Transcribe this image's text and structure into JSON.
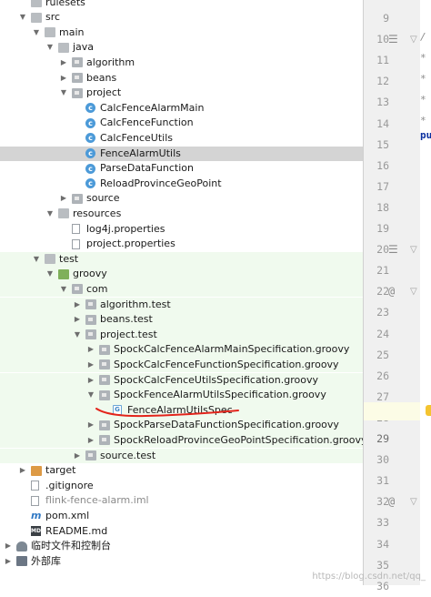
{
  "tree": [
    {
      "label": "rulesets",
      "depth": 0,
      "arrow": "",
      "icon": "folder",
      "icon_name": "folder-icon"
    },
    {
      "label": "src",
      "depth": 0,
      "arrow": "down",
      "icon": "folder",
      "icon_name": "folder-icon"
    },
    {
      "label": "main",
      "depth": 1,
      "arrow": "down",
      "icon": "folder",
      "icon_name": "folder-icon"
    },
    {
      "label": "java",
      "depth": 2,
      "arrow": "down",
      "icon": "folder",
      "icon_name": "source-root-folder-icon"
    },
    {
      "label": "algorithm",
      "depth": 3,
      "arrow": "right",
      "icon": "pkg",
      "icon_name": "package-icon"
    },
    {
      "label": "beans",
      "depth": 3,
      "arrow": "right",
      "icon": "pkg",
      "icon_name": "package-icon"
    },
    {
      "label": "project",
      "depth": 3,
      "arrow": "down",
      "icon": "pkg",
      "icon_name": "package-icon"
    },
    {
      "label": "CalcFenceAlarmMain",
      "depth": 4,
      "arrow": "",
      "icon": "cls",
      "icon_name": "class-icon"
    },
    {
      "label": "CalcFenceFunction",
      "depth": 4,
      "arrow": "",
      "icon": "cls",
      "icon_name": "class-icon"
    },
    {
      "label": "CalcFenceUtils",
      "depth": 4,
      "arrow": "",
      "icon": "cls",
      "icon_name": "class-icon"
    },
    {
      "label": "FenceAlarmUtils",
      "depth": 4,
      "arrow": "",
      "icon": "cls",
      "icon_name": "class-icon",
      "selected": true
    },
    {
      "label": "ParseDataFunction",
      "depth": 4,
      "arrow": "",
      "icon": "cls",
      "icon_name": "class-icon"
    },
    {
      "label": "ReloadProvinceGeoPoint",
      "depth": 4,
      "arrow": "",
      "icon": "cls",
      "icon_name": "class-icon"
    },
    {
      "label": "source",
      "depth": 3,
      "arrow": "right",
      "icon": "pkg",
      "icon_name": "package-icon"
    },
    {
      "label": "resources",
      "depth": 2,
      "arrow": "down",
      "icon": "folder",
      "icon_name": "resources-folder-icon"
    },
    {
      "label": "log4j.properties",
      "depth": 3,
      "arrow": "",
      "icon": "file",
      "icon_name": "properties-file-icon"
    },
    {
      "label": "project.properties",
      "depth": 3,
      "arrow": "",
      "icon": "file",
      "icon_name": "properties-file-icon"
    },
    {
      "label": "test",
      "depth": 1,
      "arrow": "down",
      "icon": "folder",
      "icon_name": "folder-icon",
      "test": true
    },
    {
      "label": "groovy",
      "depth": 2,
      "arrow": "down",
      "icon": "folder-green",
      "icon_name": "test-source-folder-icon",
      "test": true
    },
    {
      "label": "com",
      "depth": 3,
      "arrow": "down",
      "icon": "pkg",
      "icon_name": "package-icon",
      "test": true
    },
    {
      "label": "algorithm.test",
      "depth": 4,
      "arrow": "right",
      "icon": "pkg",
      "icon_name": "package-icon",
      "test": true
    },
    {
      "label": "beans.test",
      "depth": 4,
      "arrow": "right",
      "icon": "pkg",
      "icon_name": "package-icon",
      "test": true
    },
    {
      "label": "project.test",
      "depth": 4,
      "arrow": "down",
      "icon": "pkg",
      "icon_name": "package-icon",
      "test": true
    },
    {
      "label": "SpockCalcFenceAlarmMainSpecification.groovy",
      "depth": 5,
      "arrow": "right",
      "icon": "pkg",
      "icon_name": "package-icon",
      "test": true
    },
    {
      "label": "SpockCalcFenceFunctionSpecification.groovy",
      "depth": 5,
      "arrow": "right",
      "icon": "pkg",
      "icon_name": "package-icon",
      "test": true
    },
    {
      "label": "SpockCalcFenceUtilsSpecification.groovy",
      "depth": 5,
      "arrow": "right",
      "icon": "pkg",
      "icon_name": "package-icon",
      "test": true
    },
    {
      "label": "SpockFenceAlarmUtilsSpecification.groovy",
      "depth": 5,
      "arrow": "down",
      "icon": "pkg",
      "icon_name": "package-icon",
      "test": true
    },
    {
      "label": "FenceAlarmUtilsSpec",
      "depth": 6,
      "arrow": "",
      "icon": "groovycls",
      "icon_name": "groovy-class-icon",
      "test": true
    },
    {
      "label": "SpockParseDataFunctionSpecification.groovy",
      "depth": 5,
      "arrow": "right",
      "icon": "pkg",
      "icon_name": "package-icon",
      "test": true
    },
    {
      "label": "SpockReloadProvinceGeoPointSpecification.groovy",
      "depth": 5,
      "arrow": "right",
      "icon": "pkg",
      "icon_name": "package-icon",
      "test": true
    },
    {
      "label": "source.test",
      "depth": 4,
      "arrow": "right",
      "icon": "pkg",
      "icon_name": "package-icon",
      "test": true
    },
    {
      "label": "target",
      "depth": 0,
      "arrow": "right",
      "icon": "folder-orange",
      "icon_name": "excluded-folder-icon"
    },
    {
      "label": ".gitignore",
      "depth": 0,
      "arrow": "",
      "icon": "file",
      "icon_name": "gitignore-file-icon"
    },
    {
      "label": "flink-fence-alarm.iml",
      "depth": 0,
      "arrow": "",
      "icon": "file",
      "icon_name": "iml-file-icon",
      "muted": true
    },
    {
      "label": "pom.xml",
      "depth": 0,
      "arrow": "",
      "icon": "xml",
      "icon_name": "maven-icon"
    },
    {
      "label": "README.md",
      "depth": 0,
      "arrow": "",
      "icon": "md",
      "icon_name": "markdown-icon"
    },
    {
      "label": "临时文件和控制台",
      "depth": -1,
      "arrow": "right",
      "icon": "scratch",
      "icon_name": "scratches-icon"
    },
    {
      "label": "外部库",
      "depth": -1,
      "arrow": "right",
      "icon": "lib",
      "icon_name": "external-libraries-icon"
    }
  ],
  "gutter": {
    "lines": [
      {
        "num": "9",
        "mark": ""
      },
      {
        "num": "10",
        "mark": "list"
      },
      {
        "num": "11",
        "mark": ""
      },
      {
        "num": "12",
        "mark": ""
      },
      {
        "num": "13",
        "mark": ""
      },
      {
        "num": "14",
        "mark": ""
      },
      {
        "num": "15",
        "mark": ""
      },
      {
        "num": "16",
        "mark": ""
      },
      {
        "num": "17",
        "mark": ""
      },
      {
        "num": "18",
        "mark": ""
      },
      {
        "num": "19",
        "mark": ""
      },
      {
        "num": "20",
        "mark": "list"
      },
      {
        "num": "21",
        "mark": ""
      },
      {
        "num": "22",
        "mark": "@"
      },
      {
        "num": "23",
        "mark": ""
      },
      {
        "num": "24",
        "mark": ""
      },
      {
        "num": "25",
        "mark": ""
      },
      {
        "num": "26",
        "mark": ""
      },
      {
        "num": "27",
        "mark": ""
      },
      {
        "num": "28",
        "mark": ""
      },
      {
        "num": "29",
        "mark": "",
        "current": true
      },
      {
        "num": "30",
        "mark": ""
      },
      {
        "num": "31",
        "mark": ""
      },
      {
        "num": "32",
        "mark": "@"
      },
      {
        "num": "33",
        "mark": ""
      },
      {
        "num": "34",
        "mark": ""
      },
      {
        "num": "35",
        "mark": ""
      },
      {
        "num": "36",
        "mark": ""
      }
    ],
    "list_glyph": "☰",
    "at_glyph": "@"
  },
  "editor": {
    "fragments": [
      "/",
      "*",
      "*",
      "*",
      "*",
      "pu"
    ]
  },
  "watermark": "https://blog.csdn.net/qq_"
}
